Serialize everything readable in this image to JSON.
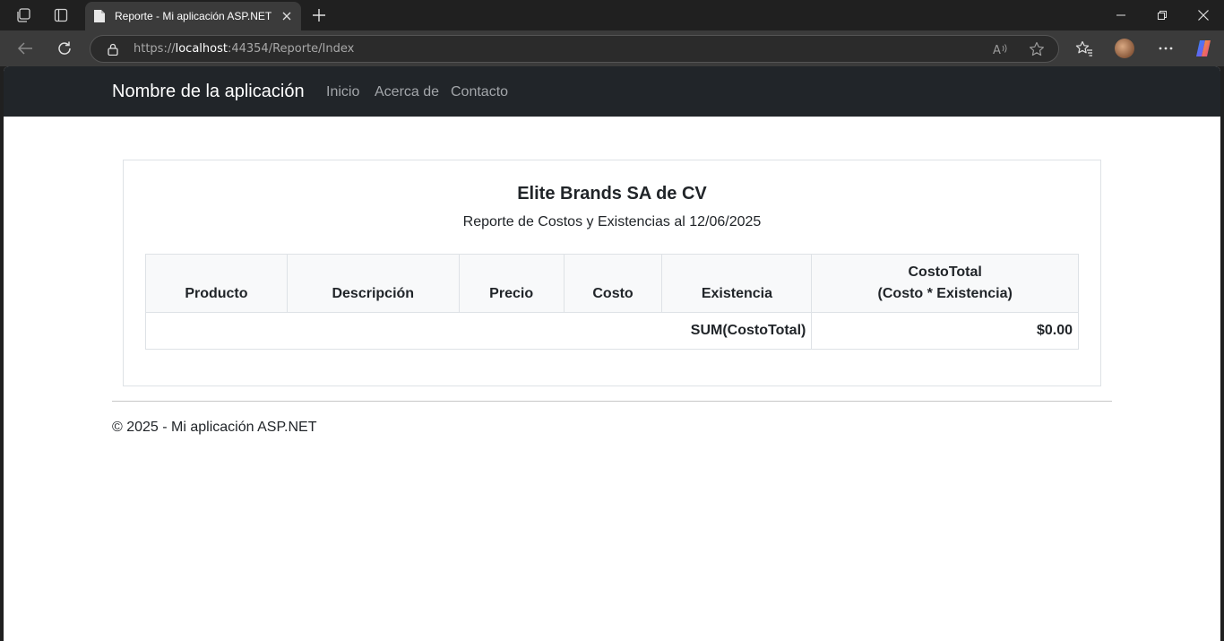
{
  "browser": {
    "tab_title": "Reporte - Mi aplicación ASP.NET",
    "url_scheme": "https://",
    "url_host": "localhost",
    "url_rest": ":44354/Reporte/Index",
    "icons": [
      "workspaces-icon",
      "tab-actions-icon",
      "page-favicon-icon",
      "close-tab-icon",
      "new-tab-icon",
      "minimize-icon",
      "restore-icon",
      "close-window-icon",
      "back-icon",
      "refresh-icon",
      "lock-icon",
      "read-aloud-icon",
      "favorite-star-icon",
      "favorites-icon",
      "profile-avatar",
      "more-options-icon",
      "copilot-icon"
    ]
  },
  "navbar": {
    "brand": "Nombre de la aplicación",
    "links": [
      "Inicio",
      "Acerca de",
      "Contacto"
    ]
  },
  "report": {
    "company": "Elite Brands SA de CV",
    "subtitle": "Reporte de Costos y Existencias al 12/06/2025",
    "columns": [
      "Producto",
      "Descripción",
      "Precio",
      "Costo",
      "Existencia"
    ],
    "last_column_line1": "CostoTotal",
    "last_column_line2": "(Costo * Existencia)",
    "rows": [],
    "sum_label": "SUM(CostoTotal)",
    "sum_value": "$0.00"
  },
  "footer": {
    "text": "© 2025 - Mi aplicación ASP.NET"
  },
  "colors": {
    "navbar_bg": "#212529",
    "page_bg": "#ffffff",
    "table_header_bg": "#f8f9fa",
    "border": "#dee2e6"
  }
}
